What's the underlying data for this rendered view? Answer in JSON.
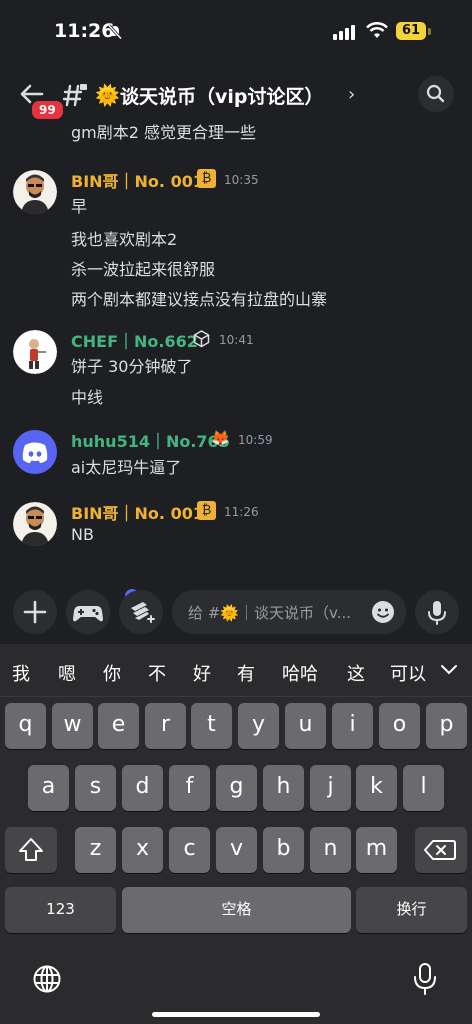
{
  "status_bar": {
    "time": "11:26",
    "battery": "61"
  },
  "header": {
    "title": "谈天说币（vip讨论区）",
    "unread_badge": "99",
    "channel_emoji": "🌞"
  },
  "messages": {
    "cut_off_line": "gm剧本2 感觉更合理一些",
    "groups": [
      {
        "username": "BIN哥｜No. 001",
        "name_color": "#f0b232",
        "tag_icon": "bitcoin-icon",
        "time": "10:35",
        "lines": [
          "早",
          "我也喜欢剧本2",
          "杀一波拉起来很舒服",
          "两个剧本都建议接点没有拉盘的山寨"
        ]
      },
      {
        "username": "CHEF｜No.662",
        "name_color": "#43b581",
        "tag_icon": "cube-icon",
        "time": "10:41",
        "lines": [
          "饼子 30分钟破了",
          "中线"
        ]
      },
      {
        "username": "huhu514｜No.765",
        "name_color": "#43b581",
        "tag_icon": "fox-icon",
        "time": "10:59",
        "lines": [
          "ai太尼玛牛逼了"
        ]
      },
      {
        "username": "BIN哥｜No. 001",
        "name_color": "#f0b232",
        "tag_icon": "bitcoin-icon",
        "time": "11:26",
        "lines": [
          "NB"
        ]
      }
    ]
  },
  "composer": {
    "placeholder": "给 #🌞｜谈天说币（v..."
  },
  "keyboard": {
    "candidates": [
      "我",
      "嗯",
      "你",
      "不",
      "好",
      "有",
      "哈哈",
      "这",
      "可以"
    ],
    "row1": [
      "q",
      "w",
      "e",
      "r",
      "t",
      "y",
      "u",
      "i",
      "o",
      "p"
    ],
    "row2": [
      "a",
      "s",
      "d",
      "f",
      "g",
      "h",
      "j",
      "k",
      "l"
    ],
    "row3": [
      "z",
      "x",
      "c",
      "v",
      "b",
      "n",
      "m"
    ],
    "num_label": "123",
    "space_label": "空格",
    "return_label": "换行"
  }
}
